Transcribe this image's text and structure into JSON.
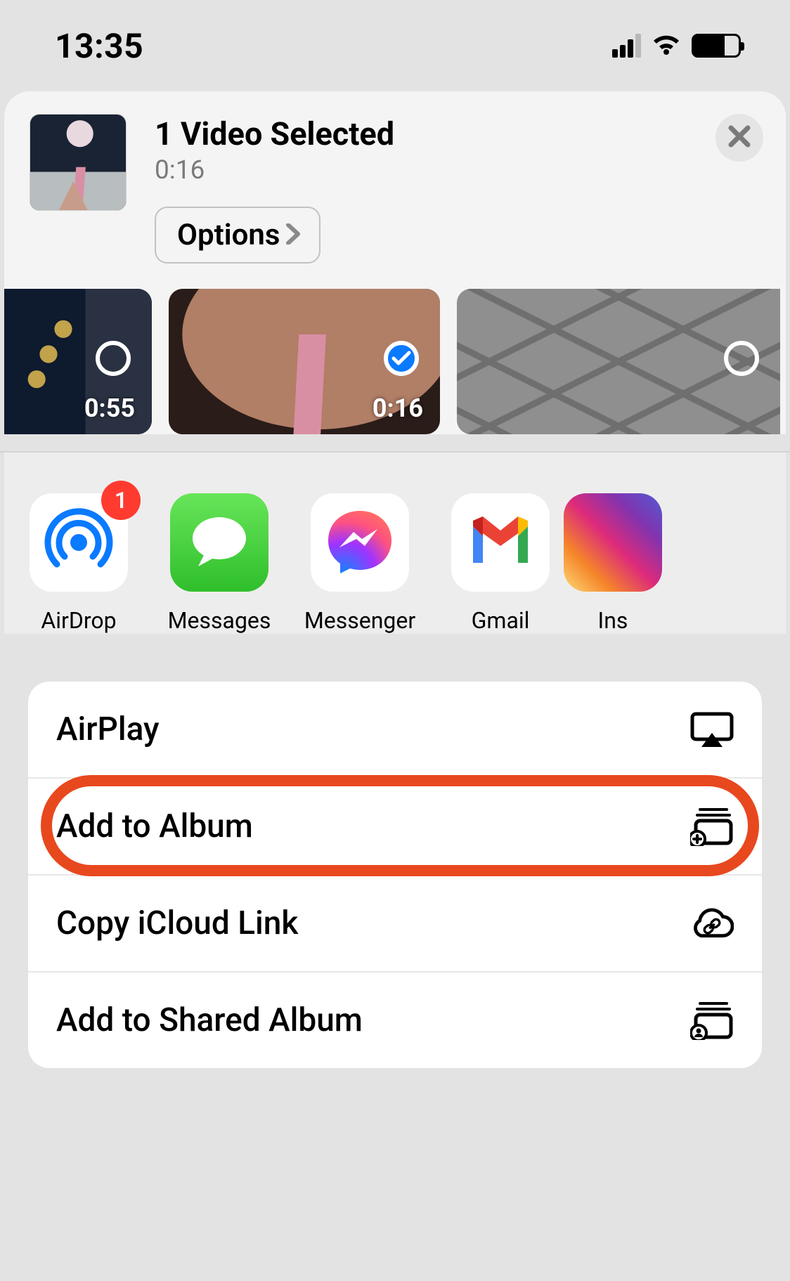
{
  "status": {
    "time": "13:35"
  },
  "header": {
    "title": "1 Video Selected",
    "subtitle": "0:16",
    "options_label": "Options"
  },
  "filmstrip": [
    {
      "duration": "0:55",
      "selected": false
    },
    {
      "duration": "0:16",
      "selected": true
    },
    {
      "duration": "",
      "selected": false
    }
  ],
  "apps": [
    {
      "name": "AirDrop",
      "badge": "1"
    },
    {
      "name": "Messages",
      "badge": null
    },
    {
      "name": "Messenger",
      "badge": null
    },
    {
      "name": "Gmail",
      "badge": null
    },
    {
      "name": "Ins",
      "badge": null
    }
  ],
  "actions": [
    {
      "label": "AirPlay",
      "icon": "airplay"
    },
    {
      "label": "Add to Album",
      "icon": "album-add"
    },
    {
      "label": "Copy iCloud Link",
      "icon": "icloud-link"
    },
    {
      "label": "Add to Shared Album",
      "icon": "shared-album"
    }
  ]
}
